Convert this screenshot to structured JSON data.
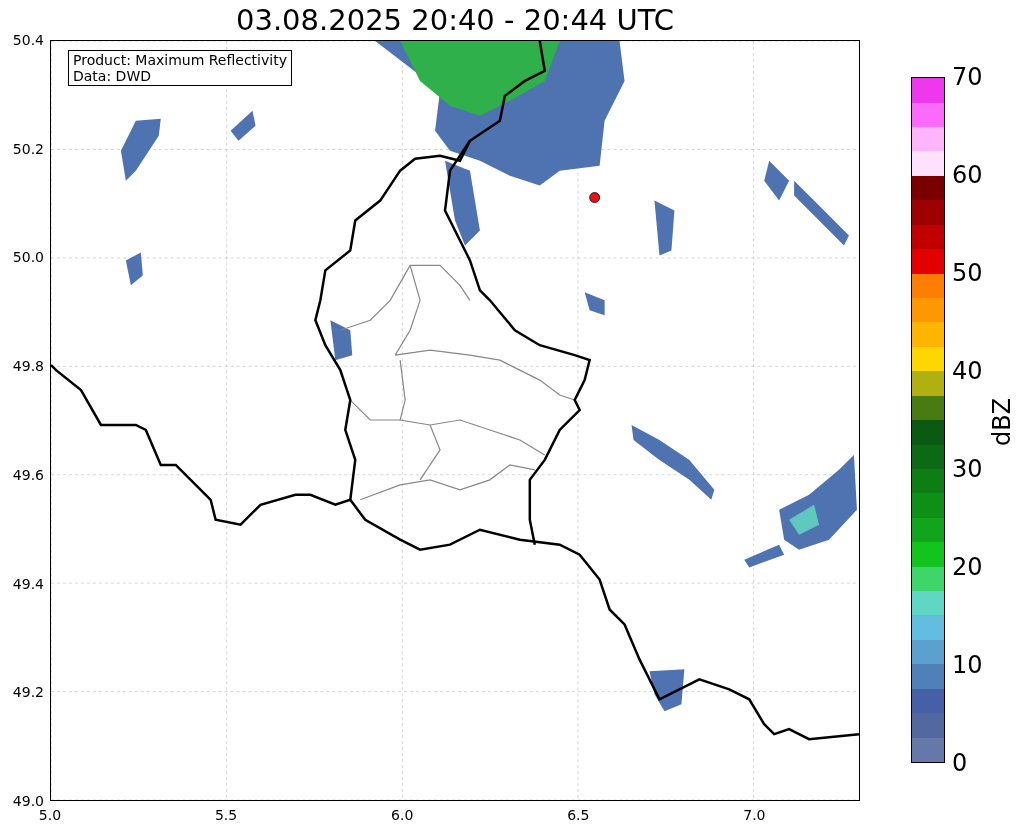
{
  "title": "03.08.2025 20:40 - 20:44 UTC",
  "legend": [
    "Product: Maximum Reflectivity",
    "Data: DWD"
  ],
  "x_ticks": [
    "5.0",
    "5.5",
    "6.0",
    "6.5",
    "7.0"
  ],
  "y_ticks": [
    "50.4",
    "50.2",
    "50.0",
    "49.8",
    "49.6",
    "49.4",
    "49.2",
    "49.0"
  ],
  "colorbar": {
    "label": "dBZ",
    "ticks": [
      "70",
      "60",
      "50",
      "40",
      "30",
      "20",
      "10",
      "0"
    ],
    "bands": [
      {
        "color": "#6678a8"
      },
      {
        "color": "#5468a0"
      },
      {
        "color": "#4660a6"
      },
      {
        "color": "#4f80b8"
      },
      {
        "color": "#5ba0ce"
      },
      {
        "color": "#62bde0"
      },
      {
        "color": "#60d6c4"
      },
      {
        "color": "#3ed66a"
      },
      {
        "color": "#14c41e"
      },
      {
        "color": "#10a51a"
      },
      {
        "color": "#0e9018"
      },
      {
        "color": "#0c7e14"
      },
      {
        "color": "#0c6a14"
      },
      {
        "color": "#0a5a14"
      },
      {
        "color": "#4a7a12"
      },
      {
        "color": "#b0b010"
      },
      {
        "color": "#ffd700"
      },
      {
        "color": "#ffb400"
      },
      {
        "color": "#ff9800"
      },
      {
        "color": "#ff7d00"
      },
      {
        "color": "#e30000"
      },
      {
        "color": "#c00000"
      },
      {
        "color": "#9c0000"
      },
      {
        "color": "#7a0000"
      },
      {
        "color": "#ffe0fd"
      },
      {
        "color": "#ffb4fb"
      },
      {
        "color": "#fb6af8"
      },
      {
        "color": "#ee38ee"
      }
    ]
  }
}
